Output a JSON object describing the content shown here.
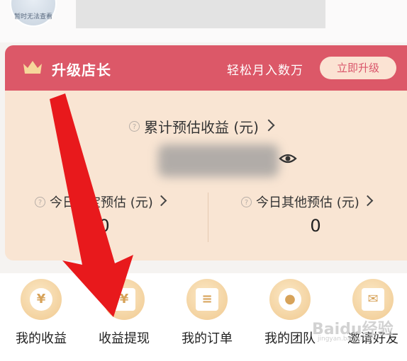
{
  "header": {
    "avatar_text": "暂时无法查看"
  },
  "banner": {
    "title": "升级店长",
    "subtitle": "轻松月入数万",
    "button_label": "立即升级",
    "color": "#dc5868"
  },
  "earnings": {
    "total_label": "累计预估收益 (元)",
    "total_amount_masked": "blurred",
    "today_taobao_label": "今日淘宝预估 (元)",
    "today_taobao_value": "0",
    "today_other_label": "今日其他预估 (元)",
    "today_other_value": "0"
  },
  "actions": [
    {
      "label": "我的收益",
      "icon": "yen-icon"
    },
    {
      "label": "收益提现",
      "icon": "withdraw-icon"
    },
    {
      "label": "我的订单",
      "icon": "order-icon"
    },
    {
      "label": "我的团队",
      "icon": "team-icon"
    },
    {
      "label": "邀请好友",
      "icon": "invite-icon"
    }
  ],
  "watermark": {
    "text": "Baidu经验",
    "sub": "jingyan.baidu.com"
  },
  "colors": {
    "card_bg": "#f9e5d3",
    "arrow": "#e8191c",
    "gold": "#f0c98f"
  }
}
